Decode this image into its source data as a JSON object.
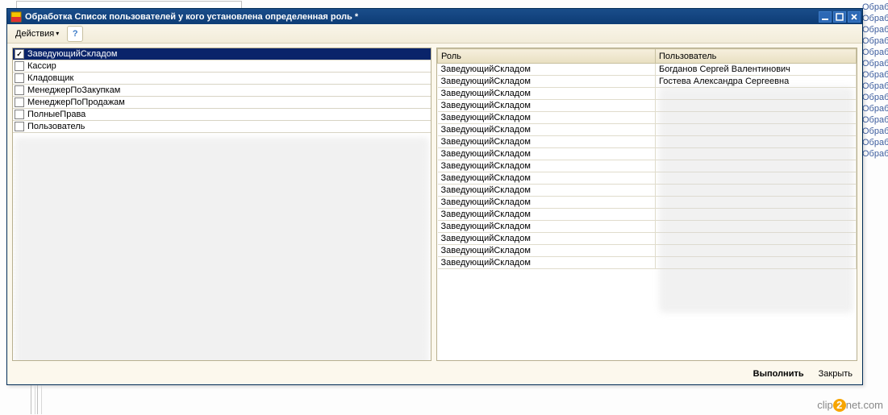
{
  "window": {
    "title": "Обработка  Список пользователей у кого установлена определенная роль *"
  },
  "toolbar": {
    "actions_label": "Действия"
  },
  "roles": [
    {
      "label": "ЗаведующийСкладом",
      "checked": true,
      "selected": true
    },
    {
      "label": "Кассир",
      "checked": false,
      "selected": false
    },
    {
      "label": "Кладовщик",
      "checked": false,
      "selected": false
    },
    {
      "label": "МенеджерПоЗакупкам",
      "checked": false,
      "selected": false
    },
    {
      "label": "МенеджерПоПродажам",
      "checked": false,
      "selected": false
    },
    {
      "label": "ПолныеПрава",
      "checked": false,
      "selected": false
    },
    {
      "label": "Пользователь",
      "checked": false,
      "selected": false
    }
  ],
  "result_table": {
    "columns": {
      "role": "Роль",
      "user": "Пользователь"
    },
    "rows": [
      {
        "role": "ЗаведующийСкладом",
        "user": "Богданов Сергей Валентинович"
      },
      {
        "role": "ЗаведующийСкладом",
        "user": "Гостева Александра Сергеевна"
      },
      {
        "role": "ЗаведующийСкладом",
        "user": ""
      },
      {
        "role": "ЗаведующийСкладом",
        "user": ""
      },
      {
        "role": "ЗаведующийСкладом",
        "user": ""
      },
      {
        "role": "ЗаведующийСкладом",
        "user": ""
      },
      {
        "role": "ЗаведующийСкладом",
        "user": ""
      },
      {
        "role": "ЗаведующийСкладом",
        "user": ""
      },
      {
        "role": "ЗаведующийСкладом",
        "user": ""
      },
      {
        "role": "ЗаведующийСкладом",
        "user": ""
      },
      {
        "role": "ЗаведующийСкладом",
        "user": ""
      },
      {
        "role": "ЗаведующийСкладом",
        "user": ""
      },
      {
        "role": "ЗаведующийСкладом",
        "user": ""
      },
      {
        "role": "ЗаведующийСкладом",
        "user": ""
      },
      {
        "role": "ЗаведующийСкладом",
        "user": ""
      },
      {
        "role": "ЗаведующийСкладом",
        "user": ""
      },
      {
        "role": "ЗаведующийСкладом",
        "user": ""
      }
    ]
  },
  "footer": {
    "execute": "Выполнить",
    "close": "Закрыть"
  },
  "background_labels": {
    "top_bar": "",
    "right_col": [
      "Обрабс",
      "Обрабс",
      "Обрабс",
      "Обрабс",
      "Обрабс",
      "Обрабс",
      "Обрабс",
      "Обрабс",
      "Обрабс",
      "Обрабс",
      "Обрабс",
      "Обрабс",
      "Обрабс",
      "Обрабс"
    ]
  },
  "watermark": {
    "a": "clip",
    "b": "2",
    "c": "net",
    "d": ".com"
  }
}
